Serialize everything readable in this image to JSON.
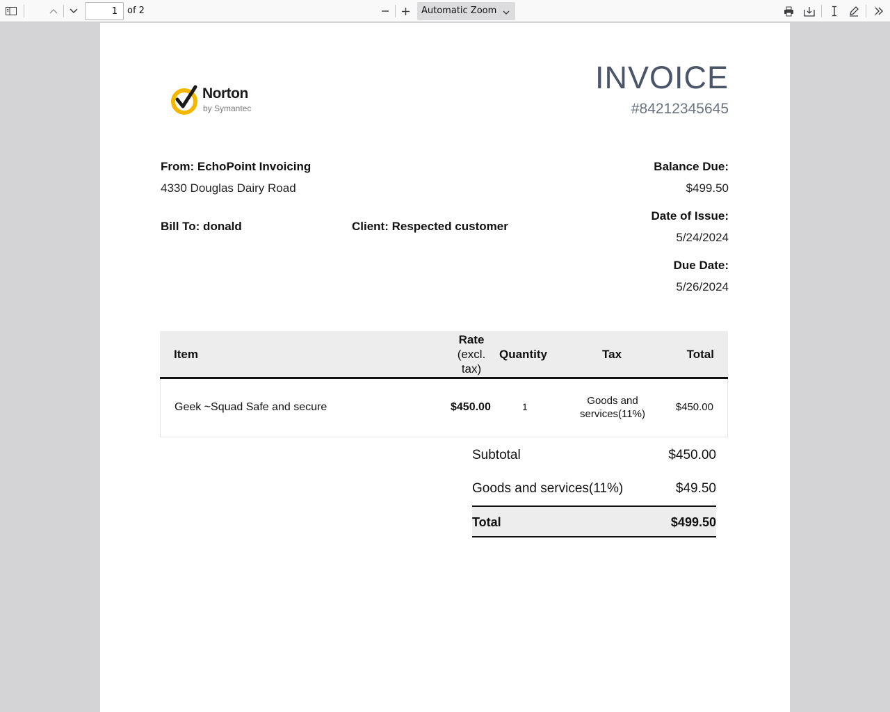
{
  "toolbar": {
    "page_number": "1",
    "page_count": "of 2",
    "zoom": "Automatic Zoom",
    "icons": [
      "sidebar-toggle-icon",
      "previous-page-icon",
      "next-page-icon",
      "zoom-out-icon",
      "zoom-in-icon",
      "print-icon",
      "download-icon",
      "text-cursor-icon",
      "draw-icon",
      "more-tools-icon"
    ]
  },
  "invoice": {
    "logo": {
      "brand": "Norton",
      "sub": "by Symantec"
    },
    "title": "INVOICE",
    "number": "#84212345645",
    "from_label": "From: EchoPoint Invoicing",
    "address": "4330 Douglas Dairy Road",
    "bill_to": "Bill To: donald",
    "client": "Client: Respected customer",
    "balance_due_label": "Balance Due:",
    "balance_due": "$499.50",
    "issue_label": "Date of Issue:",
    "issue_date": "5/24/2024",
    "due_label": "Due Date:",
    "due_date": "5/26/2024",
    "columns": {
      "item": "Item",
      "rate_1": "Rate",
      "rate_2": "(excl.",
      "rate_3": "tax)",
      "quantity": "Quantity",
      "tax": "Tax",
      "total": "Total"
    },
    "rows": [
      {
        "item": "Geek ~Squad Safe and secure",
        "rate": "$450.00",
        "quantity": "1",
        "tax_1": "Goods and",
        "tax_2": "services(11%)",
        "total": "$450.00"
      }
    ],
    "subtotal_label": "Subtotal",
    "subtotal": "$450.00",
    "tax_label": "Goods and services(11%)",
    "tax_amount": "$49.50",
    "total_label": "Total",
    "total": "$499.50"
  },
  "colors": {
    "accent_logo": "#f5b800",
    "title": "#4a5568"
  }
}
